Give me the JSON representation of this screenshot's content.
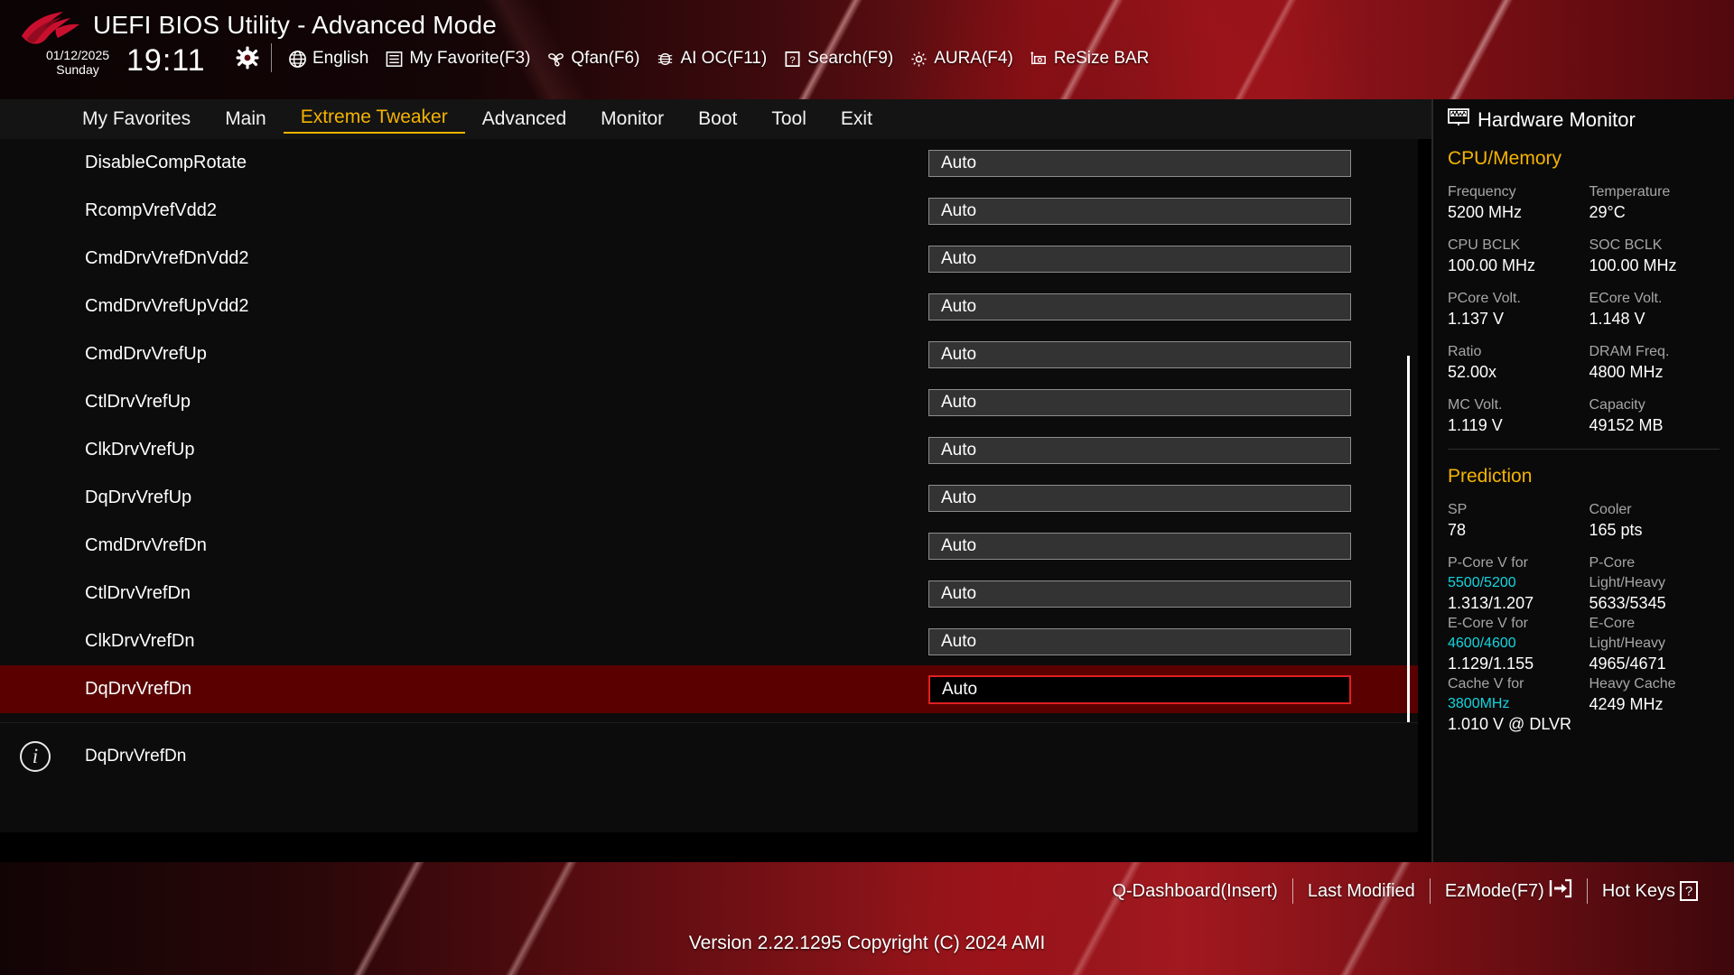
{
  "header": {
    "title": "UEFI BIOS Utility - Advanced Mode",
    "date": "01/12/2025",
    "day": "Sunday",
    "time": "19:11",
    "gear_icon": "gear-icon",
    "toolbar": [
      {
        "icon": "globe-icon",
        "label": "English"
      },
      {
        "icon": "list-icon",
        "label": "My Favorite(F3)"
      },
      {
        "icon": "fan-icon",
        "label": "Qfan(F6)"
      },
      {
        "icon": "chip-icon",
        "label": "AI OC(F11)"
      },
      {
        "icon": "question-box-icon",
        "label": "Search(F9)"
      },
      {
        "icon": "aura-icon",
        "label": "AURA(F4)"
      },
      {
        "icon": "gpu-icon",
        "label": "ReSize BAR"
      }
    ]
  },
  "tabs": [
    {
      "label": "My Favorites",
      "active": false
    },
    {
      "label": "Main",
      "active": false
    },
    {
      "label": "Extreme Tweaker",
      "active": true
    },
    {
      "label": "Advanced",
      "active": false
    },
    {
      "label": "Monitor",
      "active": false
    },
    {
      "label": "Boot",
      "active": false
    },
    {
      "label": "Tool",
      "active": false
    },
    {
      "label": "Exit",
      "active": false
    }
  ],
  "settings": [
    {
      "label": "DisableCompRotate",
      "value": "Auto",
      "selected": false
    },
    {
      "label": "RcompVrefVdd2",
      "value": "Auto",
      "selected": false
    },
    {
      "label": "CmdDrvVrefDnVdd2",
      "value": "Auto",
      "selected": false
    },
    {
      "label": "CmdDrvVrefUpVdd2",
      "value": "Auto",
      "selected": false
    },
    {
      "label": "CmdDrvVrefUp",
      "value": "Auto",
      "selected": false
    },
    {
      "label": "CtlDrvVrefUp",
      "value": "Auto",
      "selected": false
    },
    {
      "label": "ClkDrvVrefUp",
      "value": "Auto",
      "selected": false
    },
    {
      "label": "DqDrvVrefUp",
      "value": "Auto",
      "selected": false
    },
    {
      "label": "CmdDrvVrefDn",
      "value": "Auto",
      "selected": false
    },
    {
      "label": "CtlDrvVrefDn",
      "value": "Auto",
      "selected": false
    },
    {
      "label": "ClkDrvVrefDn",
      "value": "Auto",
      "selected": false
    },
    {
      "label": "DqDrvVrefDn",
      "value": "Auto",
      "selected": true
    }
  ],
  "info": {
    "icon": "info-icon",
    "text": "DqDrvVrefDn"
  },
  "hardware_monitor": {
    "title": "Hardware Monitor",
    "title_icon": "monitor-waveform-icon",
    "sections": [
      {
        "name": "CPU/Memory",
        "color": "#f5b301",
        "items": [
          {
            "key": "Frequency",
            "value": "5200 MHz"
          },
          {
            "key": "Temperature",
            "value": "29°C"
          },
          {
            "key": "CPU BCLK",
            "value": "100.00 MHz"
          },
          {
            "key": "SOC BCLK",
            "value": "100.00 MHz"
          },
          {
            "key": "PCore Volt.",
            "value": "1.137 V"
          },
          {
            "key": "ECore Volt.",
            "value": "1.148 V"
          },
          {
            "key": "Ratio",
            "value": "52.00x"
          },
          {
            "key": "DRAM Freq.",
            "value": "4800 MHz"
          },
          {
            "key": "MC Volt.",
            "value": "1.119 V"
          },
          {
            "key": "Capacity",
            "value": "49152 MB"
          }
        ]
      }
    ],
    "prediction": {
      "name": "Prediction",
      "color": "#f5b301",
      "top": [
        {
          "key": "SP",
          "value": "78"
        },
        {
          "key": "Cooler",
          "value": "165 pts"
        }
      ],
      "blocks": [
        {
          "left_key_line1": "P-Core V for",
          "left_key_line2": "5500/5200",
          "left_value": "1.313/1.207",
          "right_key_line1": "P-Core",
          "right_key_line2": "Light/Heavy",
          "right_value": "5633/5345"
        },
        {
          "left_key_line1": "E-Core V for",
          "left_key_line2": "4600/4600",
          "left_value": "1.129/1.155",
          "right_key_line1": "E-Core",
          "right_key_line2": "Light/Heavy",
          "right_value": "4965/4671"
        },
        {
          "left_key_line1": "Cache V for",
          "left_key_line2": "3800MHz",
          "left_value": "1.010 V @ DLVR",
          "right_key_line1": "Heavy Cache",
          "right_key_line2": "",
          "right_value": "4249 MHz"
        }
      ]
    }
  },
  "bottom_bar": {
    "links": [
      {
        "label": "Q-Dashboard(Insert)",
        "icon": ""
      },
      {
        "label": "Last Modified",
        "icon": ""
      },
      {
        "label": "EzMode(F7)",
        "icon": "exit-arrow-icon"
      },
      {
        "label": "Hot Keys",
        "icon": "question-box-icon"
      }
    ],
    "version": "Version 2.22.1295 Copyright (C) 2024 AMI"
  },
  "colors": {
    "accent_yellow": "#f5b301",
    "accent_cyan": "#11d6e0",
    "selected_row": "#5a0000",
    "selected_border": "#e02020",
    "field_bg": "#333333"
  }
}
